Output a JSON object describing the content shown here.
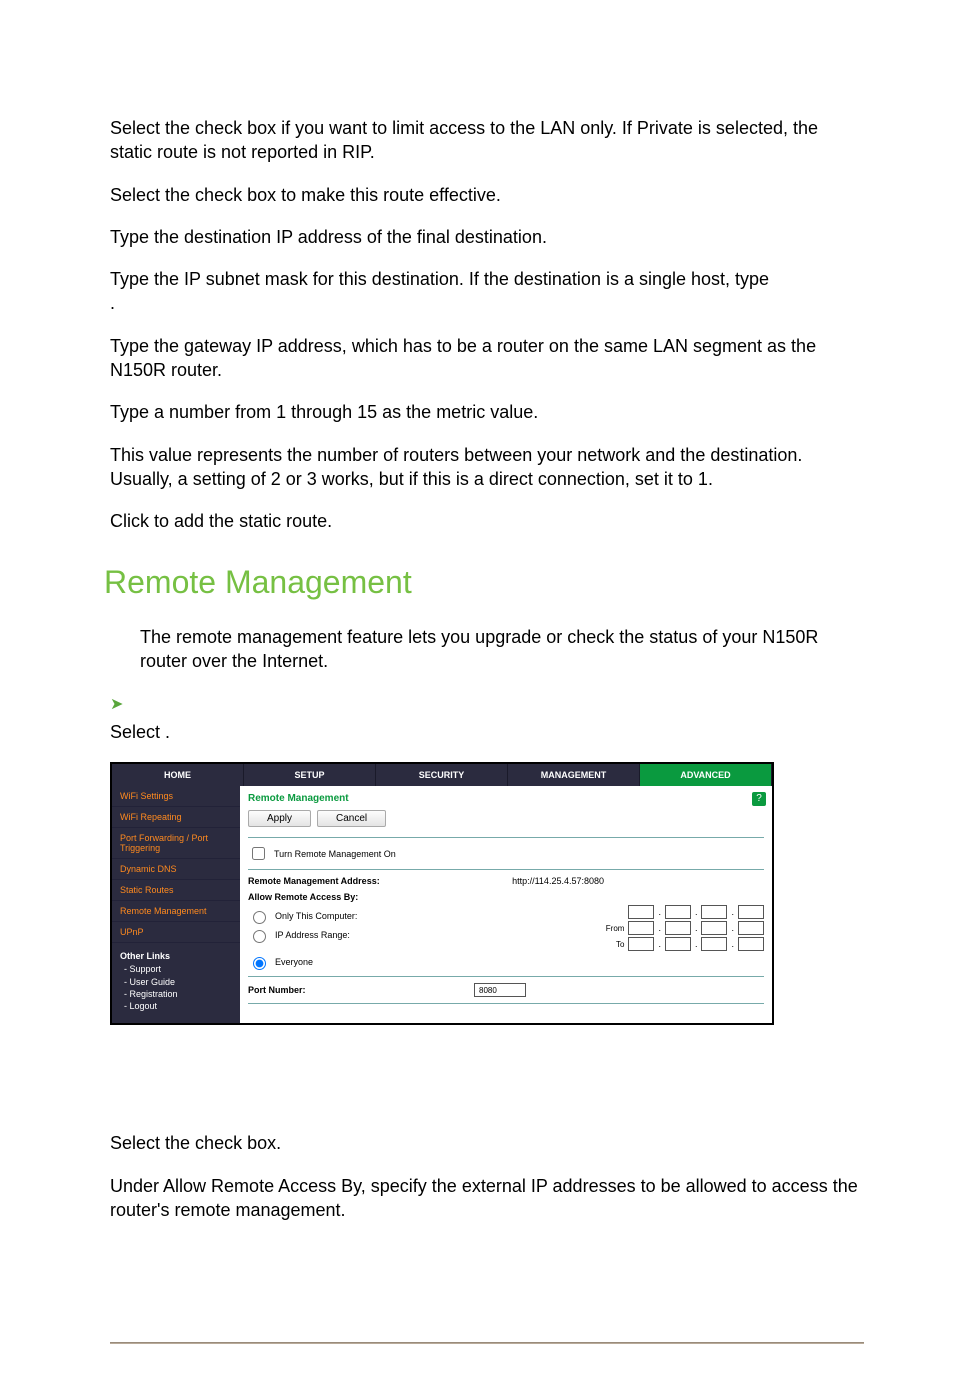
{
  "paragraphs": {
    "p1": "Select the              check box if you want to limit access to the LAN only. If Private is selected, the static route is not reported in RIP.",
    "p2": "Select the            check box to make this route effective.",
    "p3": "Type the destination IP address of the final destination.",
    "p4": "Type the IP subnet mask for this destination. If the destination is a single host, type",
    "p5": "                           .",
    "p6": "Type the gateway IP address, which has to be a router on the same LAN segment as the N150R router.",
    "p7": "Type a number from 1 through 15 as the metric value.",
    "p8": "This value represents the number of routers between your network and the destination. Usually, a setting of 2 or 3 works, but if this is a direct connection, set it to 1.",
    "p9": "Click          to add the static route.",
    "p10": "The remote management feature lets you upgrade or check the status of your N150R router over the Internet.",
    "p11": "Select                                                                            .",
    "p12": "Select the                                                 check box.",
    "p13": "Under Allow Remote Access By, specify the external IP addresses to be allowed to access the router's remote management."
  },
  "section_heading": "Remote Management",
  "router_ui": {
    "tabs": [
      "HOME",
      "SETUP",
      "SECURITY",
      "MANAGEMENT",
      "ADVANCED"
    ],
    "active_tab_index": 4,
    "sidebar": [
      "WiFi Settings",
      "WiFi Repeating",
      "Port Forwarding / Port Triggering",
      "Dynamic DNS",
      "Static Routes",
      "Remote Management",
      "UPnP"
    ],
    "other_links_header": "Other Links",
    "other_links": [
      "- Support",
      "- User Guide",
      "- Registration",
      "- Logout"
    ],
    "pane_title": "Remote Management",
    "help_badge": "?",
    "apply_label": "Apply",
    "cancel_label": "Cancel",
    "checkbox_label": "Turn Remote Management On",
    "addr_label": "Remote Management Address:",
    "addr_value": "http://114.25.4.57:8080",
    "allow_label": "Allow Remote Access By:",
    "opt_this_computer": "Only This Computer:",
    "opt_ip_range": "IP Address Range:",
    "opt_everyone": "Everyone",
    "from_label": "From",
    "to_label": "To",
    "port_label": "Port Number:",
    "port_value": "8080"
  }
}
